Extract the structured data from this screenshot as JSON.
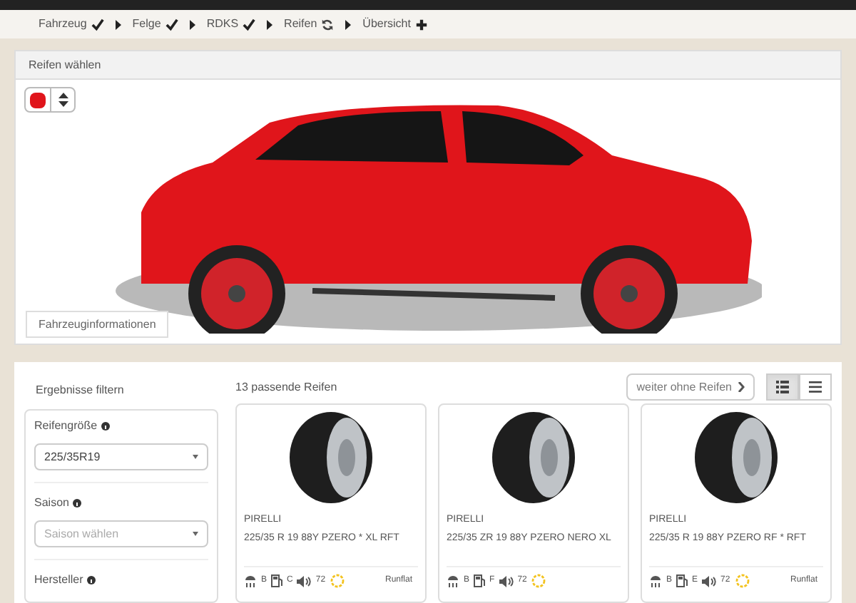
{
  "steps": [
    {
      "label": "Fahrzeug",
      "kind": "done"
    },
    {
      "label": "Felge",
      "kind": "done"
    },
    {
      "label": "RDKS",
      "kind": "done"
    },
    {
      "label": "Reifen",
      "kind": "current"
    },
    {
      "label": "Übersicht",
      "kind": "todo"
    }
  ],
  "vehicle_panel": {
    "title": "Reifen wählen",
    "color": "#e0151b",
    "info_button": "Fahrzeuginformationen"
  },
  "filter": {
    "title": "Ergebnisse filtern",
    "fields": [
      {
        "label": "Reifengröße",
        "value": "225/35R19"
      },
      {
        "label": "Saison",
        "placeholder": "Saison wählen"
      },
      {
        "label": "Hersteller"
      }
    ]
  },
  "results": {
    "count": "13 passende Reifen",
    "skip_button": "weiter ohne Reifen",
    "views": [
      {
        "kind": "cards",
        "selected": true
      },
      {
        "kind": "list",
        "selected": false
      }
    ]
  },
  "tires": [
    {
      "brand": "PIRELLI",
      "model": "225/35 R 19 88Y PZERO * XL RFT",
      "wet": "B",
      "fuel": "C",
      "noise": "72",
      "runflat": "Runflat"
    },
    {
      "brand": "PIRELLI",
      "model": "225/35 ZR 19 88Y PZERO NERO XL",
      "wet": "B",
      "fuel": "F",
      "noise": "72"
    },
    {
      "brand": "PIRELLI",
      "model": "225/35 R 19 88Y PZERO RF * RFT",
      "wet": "B",
      "fuel": "E",
      "noise": "72",
      "runflat": "Runflat"
    }
  ]
}
